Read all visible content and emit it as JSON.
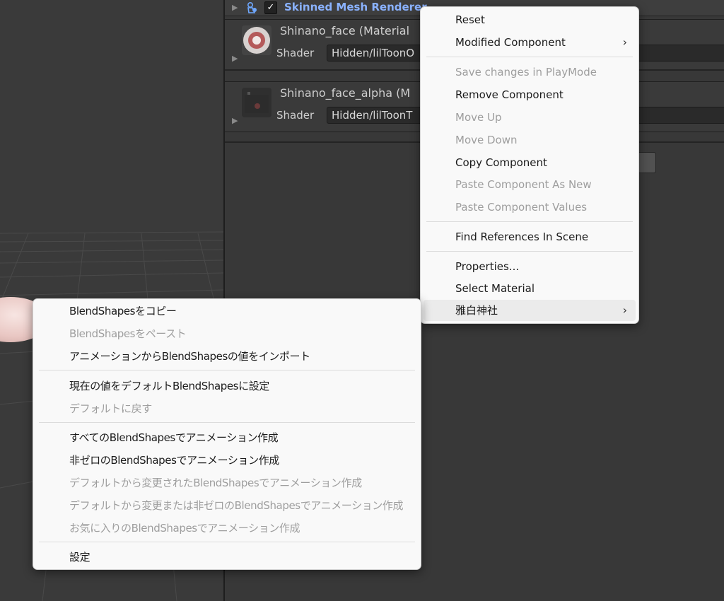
{
  "scene": {},
  "inspector": {
    "component": {
      "title": "Skinned Mesh Renderer",
      "enabled_check": "✓",
      "foldout_glyph": "▶"
    },
    "materials": [
      {
        "name": "Shinano_face (Material",
        "shader_label": "Shader",
        "shader_value": "Hidden/lilToonO"
      },
      {
        "name": "Shinano_face_alpha (M",
        "shader_label": "Shader",
        "shader_value": "Hidden/lilToonT"
      }
    ]
  },
  "component_menu": {
    "items": [
      {
        "label": "Reset",
        "enabled": true
      },
      {
        "label": "Modified Component",
        "enabled": true,
        "submenu_glyph": "›"
      },
      {
        "label": "Save changes in PlayMode",
        "enabled": false
      },
      {
        "label": "Remove Component",
        "enabled": true
      },
      {
        "label": "Move Up",
        "enabled": false
      },
      {
        "label": "Move Down",
        "enabled": false
      },
      {
        "label": "Copy Component",
        "enabled": true
      },
      {
        "label": "Paste Component As New",
        "enabled": false
      },
      {
        "label": "Paste Component Values",
        "enabled": false
      },
      {
        "label": "Find References In Scene",
        "enabled": true
      },
      {
        "label": "Properties...",
        "enabled": true
      },
      {
        "label": "Select Material",
        "enabled": true
      },
      {
        "label": "雅白神社",
        "enabled": true,
        "submenu_glyph": "›",
        "highlighted": true
      }
    ]
  },
  "blendshape_menu": {
    "items": [
      {
        "label": "BlendShapesをコピー",
        "enabled": true
      },
      {
        "label": "BlendShapesをペースト",
        "enabled": false
      },
      {
        "label": "アニメーションからBlendShapesの値をインポート",
        "enabled": true
      },
      {
        "label": "現在の値をデフォルトBlendShapesに設定",
        "enabled": true
      },
      {
        "label": "デフォルトに戻す",
        "enabled": false
      },
      {
        "label": "すべてのBlendShapesでアニメーション作成",
        "enabled": true
      },
      {
        "label": "非ゼロのBlendShapesでアニメーション作成",
        "enabled": true
      },
      {
        "label": "デフォルトから変更されたBlendShapesでアニメーション作成",
        "enabled": false
      },
      {
        "label": "デフォルトから変更または非ゼロのBlendShapesでアニメーション作成",
        "enabled": false
      },
      {
        "label": "お気に入りのBlendShapesでアニメーション作成",
        "enabled": false
      },
      {
        "label": "設定",
        "enabled": true
      }
    ]
  },
  "colors": {
    "accent_title": "#8ab2ff",
    "menu_bg": "#f9f9f9",
    "disabled_text": "#9e9e9e",
    "scene_bg": "#3a3a3a",
    "inspector_bg": "#383838"
  }
}
